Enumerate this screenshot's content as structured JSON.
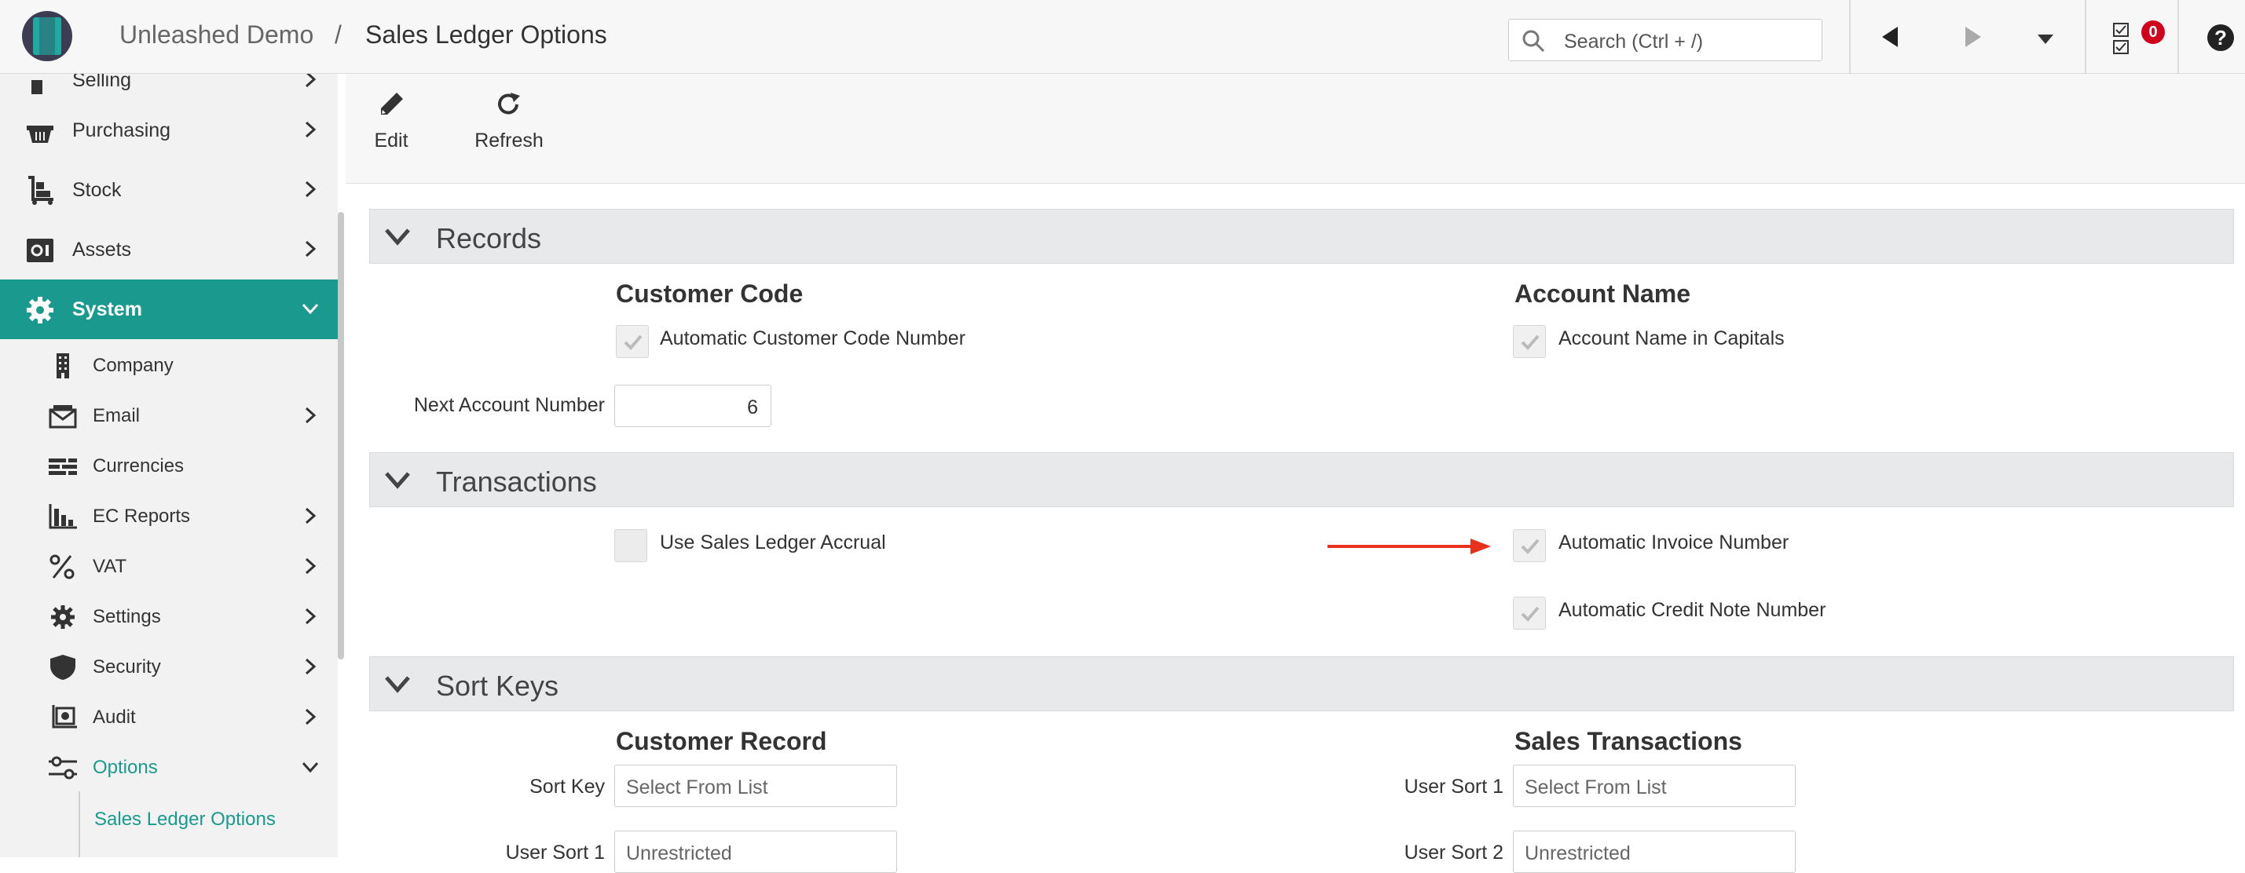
{
  "header": {
    "app_name": "Unleashed Demo",
    "separator": "/",
    "page_title": "Sales Ledger Options",
    "search_placeholder": "Search (Ctrl + /)",
    "notification_count": "0",
    "help_label": "?"
  },
  "sidebar": {
    "items": [
      {
        "label": "Selling",
        "icon": "cart-icon"
      },
      {
        "label": "Purchasing",
        "icon": "basket-icon"
      },
      {
        "label": "Stock",
        "icon": "trolley-icon"
      },
      {
        "label": "Assets",
        "icon": "safe-icon"
      },
      {
        "label": "System",
        "icon": "gear-icon"
      }
    ],
    "sub_items": [
      {
        "label": "Company",
        "icon": "building-icon"
      },
      {
        "label": "Email",
        "icon": "envelope-icon"
      },
      {
        "label": "Currencies",
        "icon": "currency-icon"
      },
      {
        "label": "EC Reports",
        "icon": "bar-chart-icon"
      },
      {
        "label": "VAT",
        "icon": "percent-icon"
      },
      {
        "label": "Settings",
        "icon": "gear-icon"
      },
      {
        "label": "Security",
        "icon": "shield-icon"
      },
      {
        "label": "Audit",
        "icon": "audit-icon"
      },
      {
        "label": "Options",
        "icon": "sliders-icon"
      }
    ],
    "leaf": {
      "label": "Sales Ledger Options"
    }
  },
  "toolbar": {
    "edit_label": "Edit",
    "refresh_label": "Refresh"
  },
  "records": {
    "title": "Records",
    "customer_code": {
      "heading": "Customer Code",
      "auto_number_label": "Automatic Customer Code Number",
      "auto_number_checked": true,
      "next_account_label": "Next Account Number",
      "next_account_value": "6"
    },
    "account_name": {
      "heading": "Account Name",
      "capitals_label": "Account Name in Capitals",
      "capitals_checked": true
    }
  },
  "transactions": {
    "title": "Transactions",
    "accrual_label": "Use Sales Ledger Accrual",
    "accrual_checked": false,
    "auto_invoice_label": "Automatic Invoice Number",
    "auto_invoice_checked": true,
    "auto_credit_label": "Automatic Credit Note Number",
    "auto_credit_checked": true
  },
  "sort_keys": {
    "title": "Sort Keys",
    "customer_record": {
      "heading": "Customer Record",
      "sort_key_label": "Sort Key",
      "sort_key_placeholder": "Select From List",
      "user_sort1_label": "User Sort 1",
      "user_sort1_placeholder": "Unrestricted"
    },
    "sales_transactions": {
      "heading": "Sales Transactions",
      "user_sort1_label": "User Sort 1",
      "user_sort1_placeholder": "Select From List",
      "user_sort2_label": "User Sort 2",
      "user_sort2_placeholder": "Unrestricted"
    }
  },
  "colors": {
    "accent": "#1a9a8e",
    "annotation_arrow": "#e8311a",
    "badge": "#d0021b"
  }
}
